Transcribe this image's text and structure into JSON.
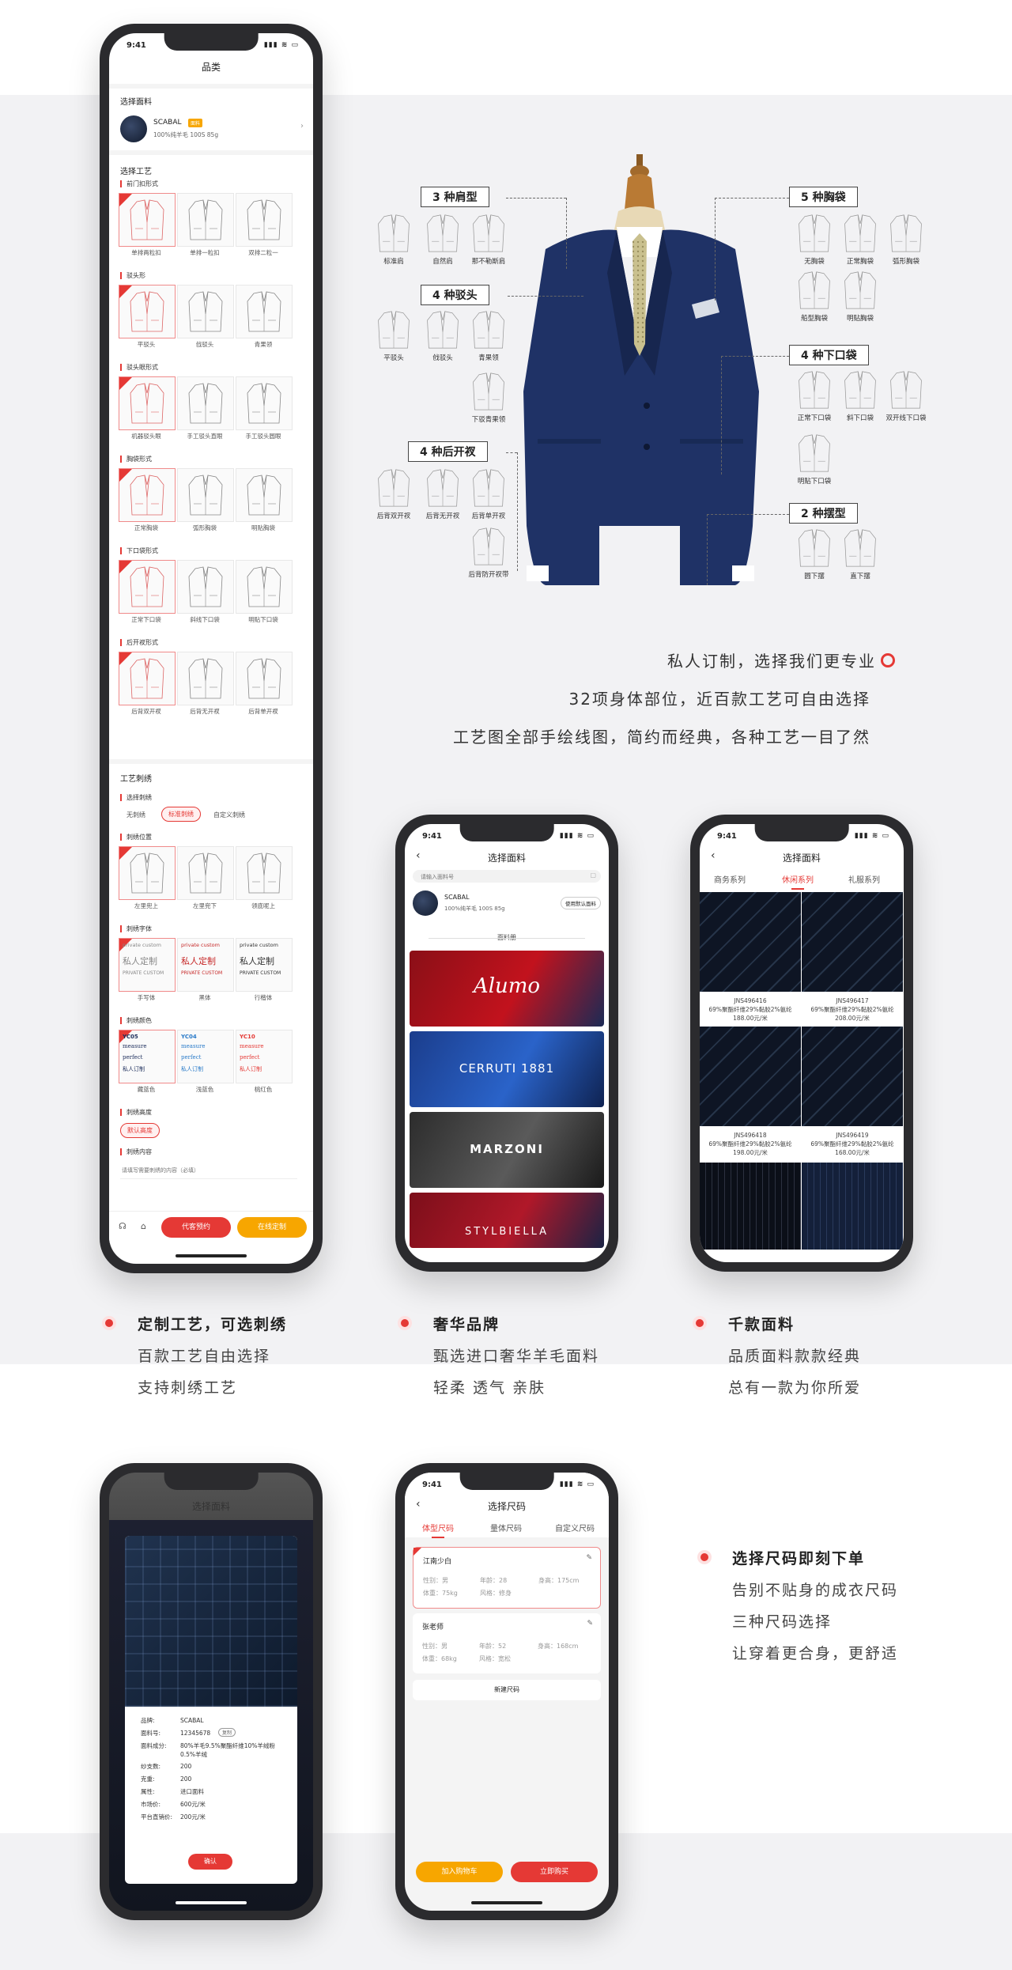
{
  "phone1": {
    "status_time": "9:41",
    "status_icons": "▮▮▮ ≋ ▭",
    "title": "品类",
    "fabric_section": "选择面料",
    "fabric_name": "SCABAL",
    "fabric_badge": "面料",
    "fabric_desc": "100%纯羊毛 100S 85g",
    "craft_section": "选择工艺",
    "craft_groups": [
      {
        "title": "前门扣形式",
        "options": [
          "单排两粒扣",
          "单排一粒扣",
          "双排二粒一"
        ]
      },
      {
        "title": "驳头形",
        "options": [
          "平驳头",
          "戗驳头",
          "青果领"
        ]
      },
      {
        "title": "驳头眼形式",
        "options": [
          "机器驳头眼",
          "手工驳头直眼",
          "手工驳头圆眼"
        ]
      },
      {
        "title": "胸袋形式",
        "options": [
          "正常胸袋",
          "弧形胸袋",
          "明贴胸袋"
        ]
      },
      {
        "title": "下口袋形式",
        "options": [
          "正常下口袋",
          "斜线下口袋",
          "明贴下口袋"
        ]
      },
      {
        "title": "后开衩形式",
        "options": [
          "后背双开衩",
          "后背无开衩",
          "后背单开衩"
        ]
      }
    ],
    "embroidery_section": "工艺刺绣",
    "emb_select_title": "选择刺绣",
    "emb_select_options": [
      "无刺绣",
      "标准刺绣",
      "自定义刺绣"
    ],
    "emb_position_title": "刺绣位置",
    "emb_position_options": [
      "左里兜上",
      "左里兜下",
      "领底呢上"
    ],
    "emb_font_title": "刺绣字体",
    "emb_font_options": [
      "手写体",
      "黑体",
      "行楷体"
    ],
    "emb_font_samples": [
      [
        "private custom",
        "私人定制",
        "PRIVATE CUSTOM"
      ],
      [
        "private custom",
        "私人定制",
        "PRIVATE CUSTOM"
      ],
      [
        "private custom",
        "私人定制",
        "PRIVATE CUSTOM"
      ]
    ],
    "emb_color_title": "刺绣颜色",
    "emb_color_options": [
      "藏蓝色",
      "浅蓝色",
      "桃红色"
    ],
    "emb_color_codes": [
      "YC05",
      "YC04",
      "YC10"
    ],
    "emb_color_sample": [
      "measure",
      "perfect",
      "私人订制"
    ],
    "emb_height_title": "刺绣高度",
    "emb_height_value": "默认高度",
    "emb_content_title": "刺绣内容",
    "emb_content_placeholder": "请填写需要刺绣的内容（必填）",
    "btn_left": "代客预约",
    "btn_right": "在线定制"
  },
  "hero": {
    "callouts": [
      "3 种肩型",
      "4 种驳头",
      "4 种后开衩",
      "5 种胸袋",
      "4 种下口袋",
      "2 种摆型"
    ],
    "shoulder": [
      "标准肩",
      "自然肩",
      "那不勒斯肩"
    ],
    "lapel": [
      "平驳头",
      "戗驳头",
      "青果领",
      "下驳青果领"
    ],
    "vent": [
      "后背双开衩",
      "后背无开衩",
      "后背单开衩",
      "后背防开衩带"
    ],
    "chest_pocket": [
      "无胸袋",
      "正常胸袋",
      "弧形胸袋",
      "船型胸袋",
      "明贴胸袋"
    ],
    "lower_pocket": [
      "正常下口袋",
      "斜下口袋",
      "双开线下口袋",
      "明贴下口袋"
    ],
    "hem": [
      "圆下摆",
      "直下摆"
    ],
    "headline1": "私人订制，选择我们更专业",
    "headline2": "32项身体部位，近百款工艺可自由选择",
    "headline3": "工艺图全部手绘线图，简约而经典，各种工艺一目了然"
  },
  "phone2": {
    "status_time": "9:41",
    "title": "选择面料",
    "search_placeholder": "请输入面料号",
    "fabric_name": "SCABAL",
    "fabric_desc": "100%纯羊毛 100S 85g",
    "use_default": "使用默认面料",
    "catalog_title": "面料册",
    "brands": [
      "Alumo",
      "CERRUTI 1881",
      "MARZONI",
      "STYLBIELLA"
    ]
  },
  "phone3": {
    "status_time": "9:41",
    "title": "选择面料",
    "tabs": [
      "商务系列",
      "休闲系列",
      "礼服系列"
    ],
    "fabrics": [
      {
        "code": "JNS496416",
        "desc": "69%聚酯纤维29%黏胶2%氨纶",
        "price": "188.00元/米"
      },
      {
        "code": "JNS496417",
        "desc": "69%聚酯纤维29%黏胶2%氨纶",
        "price": "208.00元/米"
      },
      {
        "code": "JNS496418",
        "desc": "69%聚酯纤维29%黏胶2%氨纶",
        "price": "198.00元/米"
      },
      {
        "code": "JNS496419",
        "desc": "69%聚酯纤维29%黏胶2%氨纶",
        "price": "168.00元/米"
      }
    ]
  },
  "features": [
    {
      "title": "定制工艺，可选刺绣",
      "lines": [
        "百款工艺自由选择",
        "支持刺绣工艺"
      ]
    },
    {
      "title": "奢华品牌",
      "lines": [
        "甄选进口奢华羊毛面料",
        "轻柔 透气 亲肤"
      ]
    },
    {
      "title": "千款面料",
      "lines": [
        "品质面料款款经典",
        "总有一款为你所爱"
      ]
    },
    {
      "title": "选择尺码即刻下单",
      "lines": [
        "告别不贴身的成衣尺码",
        "三种尺码选择",
        "让穿着更合身，更舒适"
      ]
    }
  ],
  "phone4": {
    "bg_title": "选择面料",
    "rows": [
      [
        "品牌:",
        "SCABAL"
      ],
      [
        "面料号:",
        "12345678"
      ],
      [
        "面料成分:",
        "80%羊毛9.5%聚酯纤维10%羊绒粉 0.5%羊绒"
      ],
      [
        "纱支数:",
        "200"
      ],
      [
        "克重:",
        "200"
      ],
      [
        "属性:",
        "进口面料"
      ],
      [
        "市场价:",
        "600元/米"
      ],
      [
        "平台直销价:",
        "200元/米"
      ]
    ],
    "copy_badge": "复制",
    "confirm": "确认"
  },
  "phone5": {
    "status_time": "9:41",
    "title": "选择尺码",
    "tabs": [
      "体型尺码",
      "量体尺码",
      "自定义尺码"
    ],
    "profiles": [
      {
        "name": "江南少白",
        "gender": "性别：男",
        "age": "年龄：28",
        "height": "身高：175cm",
        "weight": "体重：75kg",
        "style": "风格：修身"
      },
      {
        "name": "张老师",
        "gender": "性别：男",
        "age": "年龄：52",
        "height": "身高：168cm",
        "weight": "体重：68kg",
        "style": "风格：宽松"
      }
    ],
    "new_size": "新建尺码",
    "btn_cart": "加入购物车",
    "btn_buy": "立即购买"
  },
  "colors": {
    "accent": "#e53935",
    "yellow": "#f7a600",
    "navy": "#1d2e5c",
    "band": "#f2f2f4"
  }
}
